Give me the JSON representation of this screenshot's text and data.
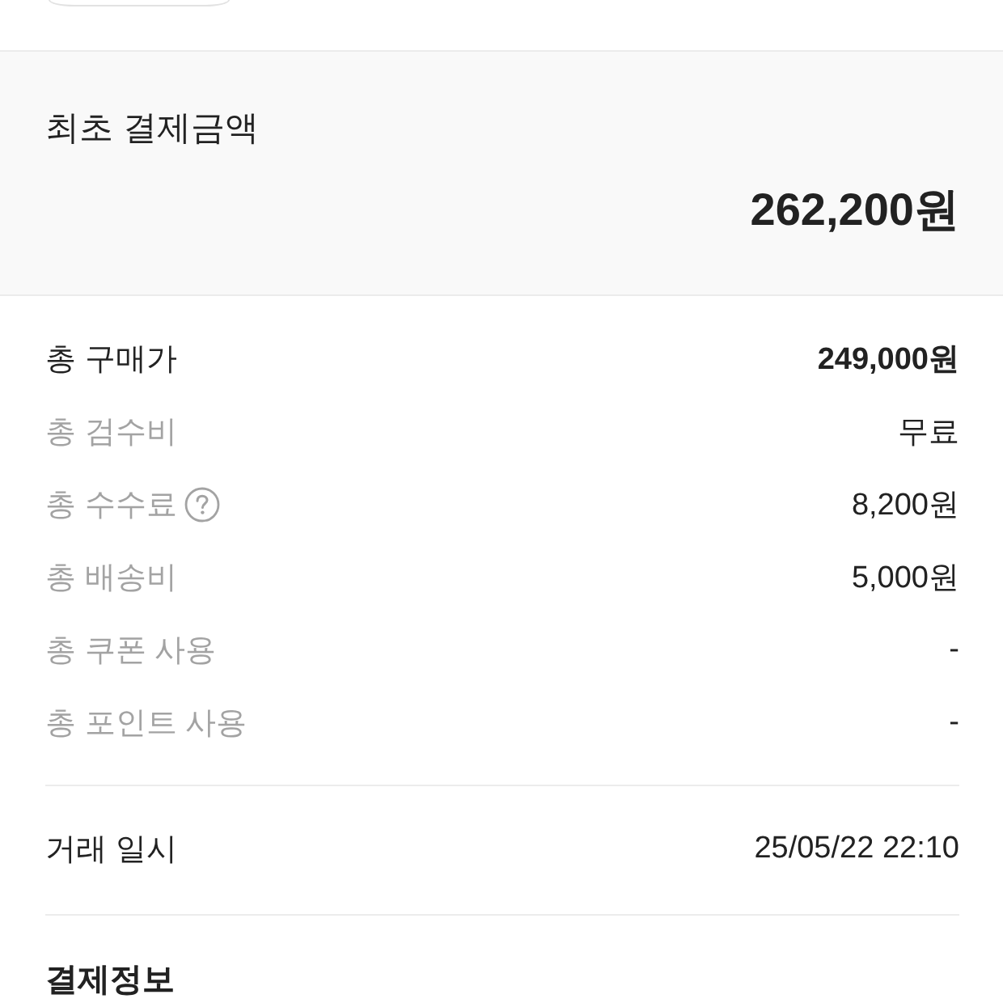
{
  "initial_payment": {
    "title": "최초 결제금액",
    "amount": "262,200원"
  },
  "breakdown": [
    {
      "label": "총 구매가",
      "value": "249,000원",
      "emphasized": true,
      "help": false
    },
    {
      "label": "총 검수비",
      "value": "무료",
      "emphasized": false,
      "help": false
    },
    {
      "label": "총 수수료",
      "value": "8,200원",
      "emphasized": false,
      "help": true
    },
    {
      "label": "총 배송비",
      "value": "5,000원",
      "emphasized": false,
      "help": false
    },
    {
      "label": "총 쿠폰 사용",
      "value": "-",
      "emphasized": false,
      "help": false
    },
    {
      "label": "총 포인트 사용",
      "value": "-",
      "emphasized": false,
      "help": false
    }
  ],
  "transaction": {
    "label": "거래 일시",
    "value": "25/05/22 22:10"
  },
  "payment_info": {
    "title": "결제정보"
  }
}
